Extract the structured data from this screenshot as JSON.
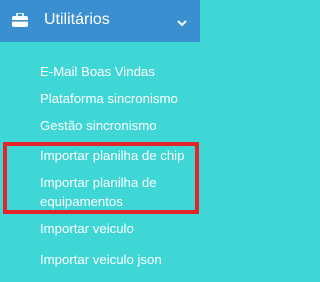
{
  "menu": {
    "title": "Utilitários",
    "header_icon": "briefcase-icon",
    "chevron_icon": "chevron-down-icon",
    "items": [
      {
        "label": "E-Mail Boas Vindas"
      },
      {
        "label": "Plataforma sincronismo"
      },
      {
        "label": "Gestão sincronismo"
      },
      {
        "label": "Importar planilha de chip"
      },
      {
        "label": "Importar planilha de equipamentos"
      },
      {
        "label": "Importar veiculo"
      },
      {
        "label": "Importar veiculo json"
      }
    ]
  },
  "colors": {
    "header_bg": "#3a8fd0",
    "submenu_bg": "#3fd6d6",
    "text": "#ffffff",
    "highlight_border": "#e3242b"
  }
}
